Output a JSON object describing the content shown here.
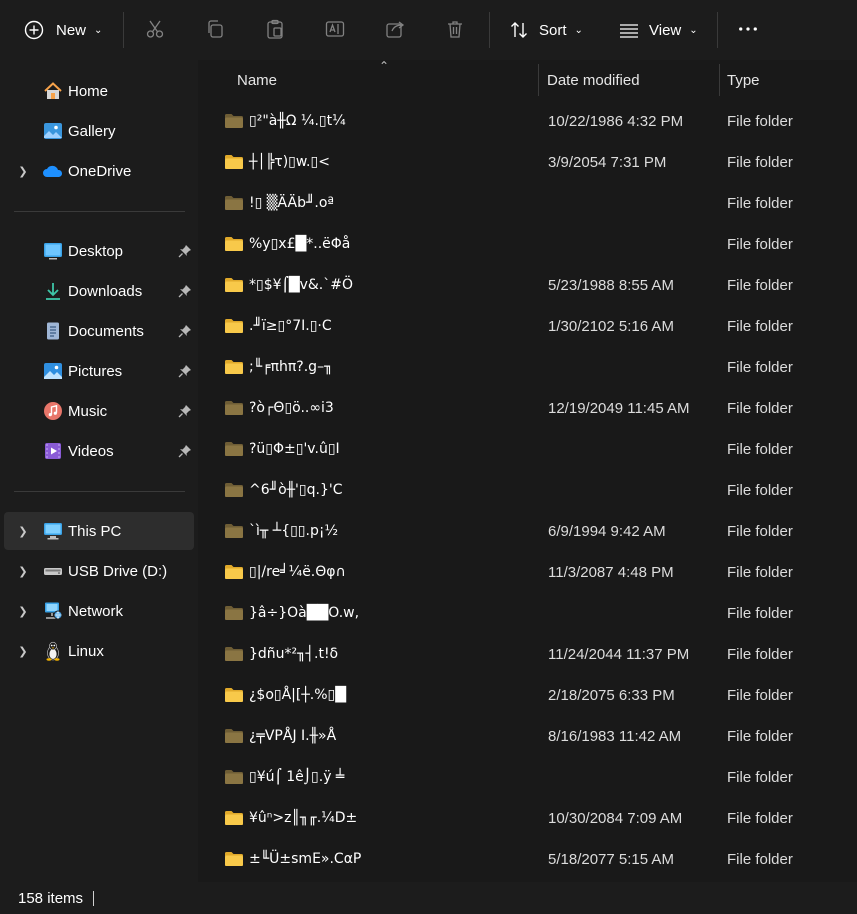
{
  "toolbar": {
    "new_label": "New",
    "sort_label": "Sort",
    "view_label": "View",
    "icons": [
      "plus-circle-icon",
      "cut-icon",
      "copy-icon",
      "paste-icon",
      "rename-icon",
      "share-icon",
      "delete-icon",
      "sort-icon",
      "view-icon",
      "more-icon"
    ]
  },
  "sidebar": {
    "quick": [
      {
        "label": "Home",
        "icon": "home-icon"
      },
      {
        "label": "Gallery",
        "icon": "gallery-icon"
      },
      {
        "label": "OneDrive",
        "icon": "onedrive-icon",
        "expandable": true
      }
    ],
    "pinned": [
      {
        "label": "Desktop",
        "icon": "desktop-icon"
      },
      {
        "label": "Downloads",
        "icon": "downloads-icon"
      },
      {
        "label": "Documents",
        "icon": "documents-icon"
      },
      {
        "label": "Pictures",
        "icon": "pictures-icon"
      },
      {
        "label": "Music",
        "icon": "music-icon"
      },
      {
        "label": "Videos",
        "icon": "videos-icon"
      }
    ],
    "devices": [
      {
        "label": "This PC",
        "icon": "this-pc-icon",
        "selected": true
      },
      {
        "label": "USB Drive (D:)",
        "icon": "usb-drive-icon"
      },
      {
        "label": "Network",
        "icon": "network-icon"
      },
      {
        "label": "Linux",
        "icon": "linux-icon"
      }
    ]
  },
  "columns": {
    "name": "Name",
    "date": "Date modified",
    "type": "Type"
  },
  "files": [
    {
      "name": "▯²\"à╫Ω ¼.▯t¼",
      "date": "10/22/1986 4:32 PM",
      "type": "File folder",
      "style": "dark"
    },
    {
      "name": " ┼│╠τ)▯w.▯<",
      "date": "3/9/2054 7:31 PM",
      "type": "File folder",
      "style": "yellow"
    },
    {
      "name": "!▯ ▒ÄÄb╜.oª",
      "date": "",
      "type": "File folder",
      "style": "dark"
    },
    {
      "name": "%y▯x£█*..ëΦå",
      "date": "",
      "type": "File folder",
      "style": "yellow"
    },
    {
      "name": "*▯$¥⌠█v&.`#Ö",
      "date": "5/23/1988 8:55 AM",
      "type": "File folder",
      "style": "yellow"
    },
    {
      "name": ".╜ï≥▯°7I.▯·C",
      "date": "1/30/2102 5:16 AM",
      "type": "File folder",
      "style": "yellow"
    },
    {
      "name": ";╙╒πhπ?.g–╖",
      "date": "",
      "type": "File folder",
      "style": "yellow"
    },
    {
      "name": "?ò┌Θ▯ö..∞i3",
      "date": "12/19/2049 11:45 AM",
      "type": "File folder",
      "style": "dark"
    },
    {
      "name": "?ü▯Φ±▯'v.û▯I",
      "date": "",
      "type": "File folder",
      "style": "dark"
    },
    {
      "name": "^6╜ò╫'▯q.}'C",
      "date": "",
      "type": "File folder",
      "style": "dark"
    },
    {
      "name": "`ì╥ ┴{▯▯.p¡½",
      "date": "6/9/1994 9:42 AM",
      "type": "File folder",
      "style": "dark"
    },
    {
      "name": "▯|/re╛¼ë.Θφ∩",
      "date": "11/3/2087 4:48 PM",
      "type": "File folder",
      "style": "yellow"
    },
    {
      "name": "}â÷}Oà██O.w,",
      "date": "",
      "type": "File folder",
      "style": "dark"
    },
    {
      "name": "}dñu*²╖┤.t!δ",
      "date": "11/24/2044 11:37 PM",
      "type": "File folder",
      "style": "dark"
    },
    {
      "name": "¿$o▯Å|[┼.%▯█",
      "date": "2/18/2075 6:33 PM",
      "type": "File folder",
      "style": "yellow"
    },
    {
      "name": "¿╤VPÅJ I.╫»Å",
      "date": "8/16/1983 11:42 AM",
      "type": "File folder",
      "style": "dark"
    },
    {
      "name": "▯¥ú⌠ 1ê⌡▯.ÿ ╧",
      "date": "",
      "type": "File folder",
      "style": "dark"
    },
    {
      "name": "¥ûⁿ>z║╖╓.¼D±",
      "date": "10/30/2084 7:09 AM",
      "type": "File folder",
      "style": "yellow"
    },
    {
      "name": "±╙Ü±smE».CαP",
      "date": "5/18/2077 5:15 AM",
      "type": "File folder",
      "style": "yellow"
    }
  ],
  "status": {
    "item_count": "158 items"
  },
  "colors": {
    "folder_yellow": "#f8c94a",
    "folder_dark": "#8a7543",
    "onedrive_blue": "#1e90ff",
    "selected_bg": "#2d2d2d"
  }
}
